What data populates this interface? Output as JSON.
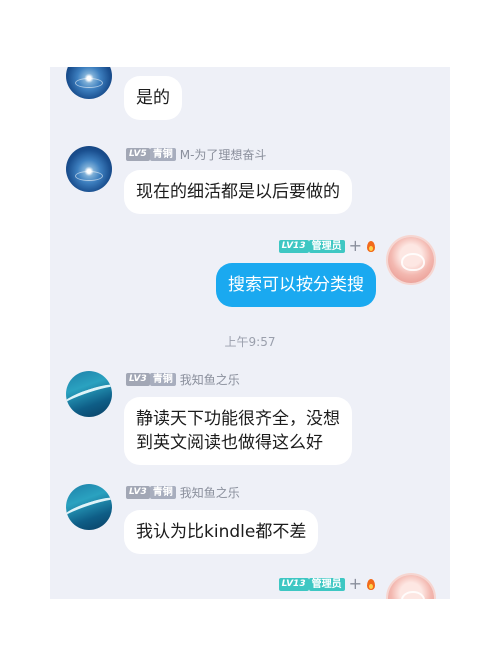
{
  "chat": {
    "messages": [
      {
        "id": "m1",
        "side": "left",
        "avatar": "water-drop-avatar",
        "text": "是的"
      },
      {
        "id": "m2",
        "side": "left",
        "avatar": "water-drop-avatar",
        "level": "LV5",
        "rank": "青铜",
        "name": "M-为了理想奋斗",
        "text": "现在的细活都是以后要做的"
      },
      {
        "id": "m3",
        "side": "right",
        "avatar": "pink-avatar",
        "level": "LV13",
        "rank": "管理员",
        "plus": "+",
        "text": "搜索可以按分类搜"
      },
      {
        "id": "t1",
        "type": "timestamp",
        "text": "上午9:57"
      },
      {
        "id": "m4",
        "side": "left",
        "avatar": "river-avatar",
        "level": "LV3",
        "rank": "青铜",
        "name": "我知鱼之乐",
        "text": "静读天下功能很齐全，没想\n到英文阅读也做得这么好"
      },
      {
        "id": "m5",
        "side": "left",
        "avatar": "river-avatar",
        "level": "LV3",
        "rank": "青铜",
        "name": "我知鱼之乐",
        "text": "我认为比kindle都不差"
      },
      {
        "id": "m6",
        "side": "right",
        "avatar": "pink-avatar",
        "level": "LV13",
        "rank": "管理员",
        "plus": "+"
      }
    ]
  },
  "colors": {
    "chat_background": "#eef0f7",
    "my_bubble": "#1aa9f0",
    "admin_badge": "#3ec7c3",
    "member_badge": "#a2a7b5"
  }
}
